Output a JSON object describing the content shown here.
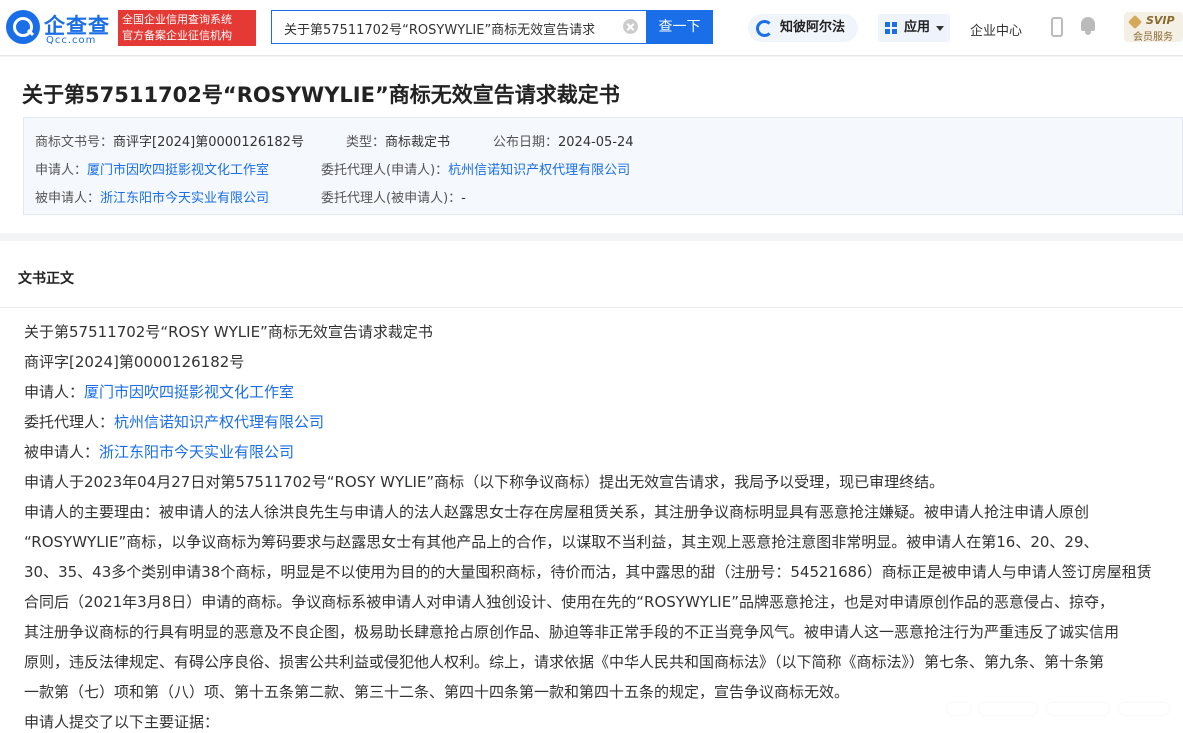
{
  "header": {
    "logo_name": "企查查",
    "logo_domain": "Qcc.com",
    "badge_line1": "全国企业信用查询系统",
    "badge_line2": "官方备案企业征信机构",
    "search_value": "关于第57511702号“ROSYWYLIE”商标无效宣告请求",
    "search_button": "查一下",
    "zhibo_label": "知彼阿尔法",
    "app_label": "应用",
    "center_label": "企业中心",
    "svip_title": "SVIP",
    "svip_sub": "会员服务"
  },
  "doc": {
    "title": "关于第57511702号“ROSYWYLIE”商标无效宣告请求裁定书",
    "meta": {
      "doc_no_label": "商标文书号：",
      "doc_no": "商评字[2024]第0000126182号",
      "type_label": "类型：",
      "type": "商标裁定书",
      "date_label": "公布日期：",
      "date": "2024-05-24",
      "applicant_label": "申请人：",
      "applicant": "厦门市因吹四挺影视文化工作室",
      "agent_app_label": "委托代理人(申请人)：",
      "agent_app": "杭州信诺知识产权代理有限公司",
      "respondent_label": "被申请人：",
      "respondent": "浙江东阳市今天实业有限公司",
      "agent_resp_label": "委托代理人(被申请人)：",
      "agent_resp": "-"
    }
  },
  "body": {
    "section_title": "文书正文",
    "l1": "关于第57511702号“ROSY WYLIE”商标无效宣告请求裁定书",
    "l2": "商评字[2024]第0000126182号",
    "l3_label": "申请人：",
    "l3_value": "厦门市因吹四挺影视文化工作室",
    "l4_label": "委托代理人：",
    "l4_value": "杭州信诺知识产权代理有限公司",
    "l5_label": "被申请人：",
    "l5_value": "浙江东阳市今天实业有限公司",
    "l6": "申请人于2023年04月27日对第57511702号“ROSY WYLIE”商标（以下称争议商标）提出无效宣告请求，我局予以受理，现已审理终结。",
    "l7": "申请人的主要理由：被申请人的法人徐洪良先生与申请人的法人赵露思女士存在房屋租赁关系，其注册争议商标明显具有恶意抢注嫌疑。被申请人抢注申请人原创",
    "l8": "“ROSYWYLIE”商标，以争议商标为筹码要求与赵露思女士有其他产品上的合作，以谋取不当利益，其主观上恶意抢注意图非常明显。被申请人在第16、20、29、",
    "l9": "30、35、43多个类别申请38个商标，明显是不以使用为目的的大量囤积商标，待价而沽，其中露思的甜（注册号：54521686）商标正是被申请人与申请人签订房屋租赁",
    "l10": "合同后（2021年3月8日）申请的商标。争议商标系被申请人对申请人独创设计、使用在先的“ROSYWYLIE”品牌恶意抢注，也是对申请原创作品的恶意侵占、掠夺，",
    "l11": "其注册争议商标的行具有明显的恶意及不良企图，极易助长肆意抢占原创作品、胁迫等非正常手段的不正当竞争风气。被申请人这一恶意抢注行为严重违反了诚实信用",
    "l12": "原则，违反法律规定、有碍公序良俗、损害公共利益或侵犯他人权利。综上，请求依据《中华人民共和国商标法》（以下简称《商标法》）第七条、第九条、第十条第",
    "l13": "一款第（七）项和第（八）项、第十五条第二款、第三十二条、第四十四条第一款和第四十五条的规定，宣告争议商标无效。",
    "l14": "申请人提交了以下主要证据："
  }
}
